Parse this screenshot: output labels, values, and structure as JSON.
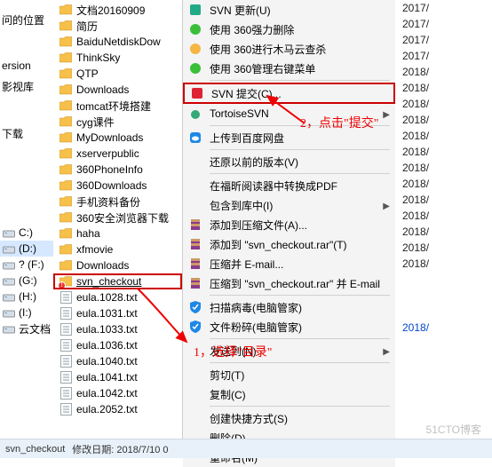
{
  "sidebar": {
    "items": [
      {
        "label": "问的位置"
      },
      {
        "label": ""
      },
      {
        "label": ""
      },
      {
        "label": "ersion"
      },
      {
        "label": "影视库"
      },
      {
        "label": ""
      },
      {
        "label": ""
      },
      {
        "label": "下载"
      }
    ],
    "drives": [
      {
        "label": "C:)"
      },
      {
        "label": "(D:)",
        "sel": true
      },
      {
        "label": "? (F:)"
      },
      {
        "label": "(G:)"
      },
      {
        "label": "(H:)"
      },
      {
        "label": "(I:)"
      },
      {
        "label": "云文档"
      }
    ]
  },
  "files": [
    {
      "icon": "folder",
      "label": "文档20160909"
    },
    {
      "icon": "folder",
      "label": "简历"
    },
    {
      "icon": "folder",
      "label": "BaiduNetdiskDow"
    },
    {
      "icon": "folder",
      "label": "ThinkSky"
    },
    {
      "icon": "folder",
      "label": "QTP"
    },
    {
      "icon": "folder",
      "label": "Downloads"
    },
    {
      "icon": "folder",
      "label": "tomcat环境搭建"
    },
    {
      "icon": "folder",
      "label": "cyg课件"
    },
    {
      "icon": "folder",
      "label": "MyDownloads"
    },
    {
      "icon": "folder",
      "label": "xserverpublic"
    },
    {
      "icon": "folder",
      "label": "360PhoneInfo"
    },
    {
      "icon": "folder",
      "label": "360Downloads"
    },
    {
      "icon": "folder",
      "label": "手机资料备份"
    },
    {
      "icon": "folder",
      "label": "360安全浏览器下载"
    },
    {
      "icon": "folder",
      "label": "haha"
    },
    {
      "icon": "folder",
      "label": "xfmovie"
    },
    {
      "icon": "folder",
      "label": "Downloads"
    },
    {
      "icon": "svn",
      "label": "svn_checkout",
      "sel": true
    },
    {
      "icon": "txt",
      "label": "eula.1028.txt"
    },
    {
      "icon": "txt",
      "label": "eula.1031.txt"
    },
    {
      "icon": "txt",
      "label": "eula.1033.txt"
    },
    {
      "icon": "txt",
      "label": "eula.1036.txt"
    },
    {
      "icon": "txt",
      "label": "eula.1040.txt"
    },
    {
      "icon": "txt",
      "label": "eula.1041.txt"
    },
    {
      "icon": "txt",
      "label": "eula.1042.txt"
    },
    {
      "icon": "txt",
      "label": "eula.2052.txt"
    }
  ],
  "menu": [
    {
      "icon": "svn-green",
      "label": "SVN 更新(U)"
    },
    {
      "icon": "ball-green",
      "label": "使用 360强力删除"
    },
    {
      "icon": "ghost",
      "label": "使用 360进行木马云查杀"
    },
    {
      "icon": "ball-green",
      "label": "使用 360管理右键菜单"
    },
    {
      "sep": true
    },
    {
      "icon": "svn-red",
      "label": "SVN 提交(C)...",
      "hi": true
    },
    {
      "icon": "tortoise",
      "label": "TortoiseSVN",
      "arrow": true
    },
    {
      "sep": true
    },
    {
      "icon": "cloud",
      "label": "上传到百度网盘"
    },
    {
      "sep": true
    },
    {
      "icon": "",
      "label": "还原以前的版本(V)"
    },
    {
      "sep": true
    },
    {
      "icon": "",
      "label": "在福昕阅读器中转换成PDF"
    },
    {
      "icon": "",
      "label": "包含到库中(I)",
      "arrow": true
    },
    {
      "icon": "rar",
      "label": "添加到压缩文件(A)..."
    },
    {
      "icon": "rar",
      "label": "添加到 \"svn_checkout.rar\"(T)"
    },
    {
      "icon": "rar",
      "label": "压缩并 E-mail..."
    },
    {
      "icon": "rar",
      "label": "压缩到 \"svn_checkout.rar\" 并 E-mail"
    },
    {
      "sep": true
    },
    {
      "icon": "shield-blue",
      "label": "扫描病毒(电脑管家)"
    },
    {
      "icon": "shield-blue",
      "label": "文件粉碎(电脑管家)"
    },
    {
      "sep": true
    },
    {
      "icon": "",
      "label": "发送到(N)",
      "arrow": true
    },
    {
      "sep": true
    },
    {
      "icon": "",
      "label": "剪切(T)"
    },
    {
      "icon": "",
      "label": "复制(C)"
    },
    {
      "sep": true
    },
    {
      "icon": "",
      "label": "创建快捷方式(S)"
    },
    {
      "icon": "",
      "label": "删除(D)"
    },
    {
      "icon": "",
      "label": "重命名(M)"
    }
  ],
  "dates": [
    "2017/",
    "2017/",
    "2017/",
    "2017/",
    "2018/",
    "2018/",
    "2018/",
    "2018/",
    "2018/",
    "2018/",
    "2018/",
    "2018/",
    "2018/",
    "2018/",
    "2018/",
    "2018/",
    "2018/",
    "",
    "",
    "",
    "2018/",
    "",
    "",
    "",
    "",
    "",
    "",
    "",
    ""
  ],
  "dates_sel_index": 20,
  "statusbar": {
    "name": "svn_checkout",
    "detail": "修改日期: 2018/7/10 0"
  },
  "watermark": "51CTO博客",
  "annotations": {
    "a1": "1，选择\"目录\"",
    "a2": "2，点击\"提交\""
  }
}
